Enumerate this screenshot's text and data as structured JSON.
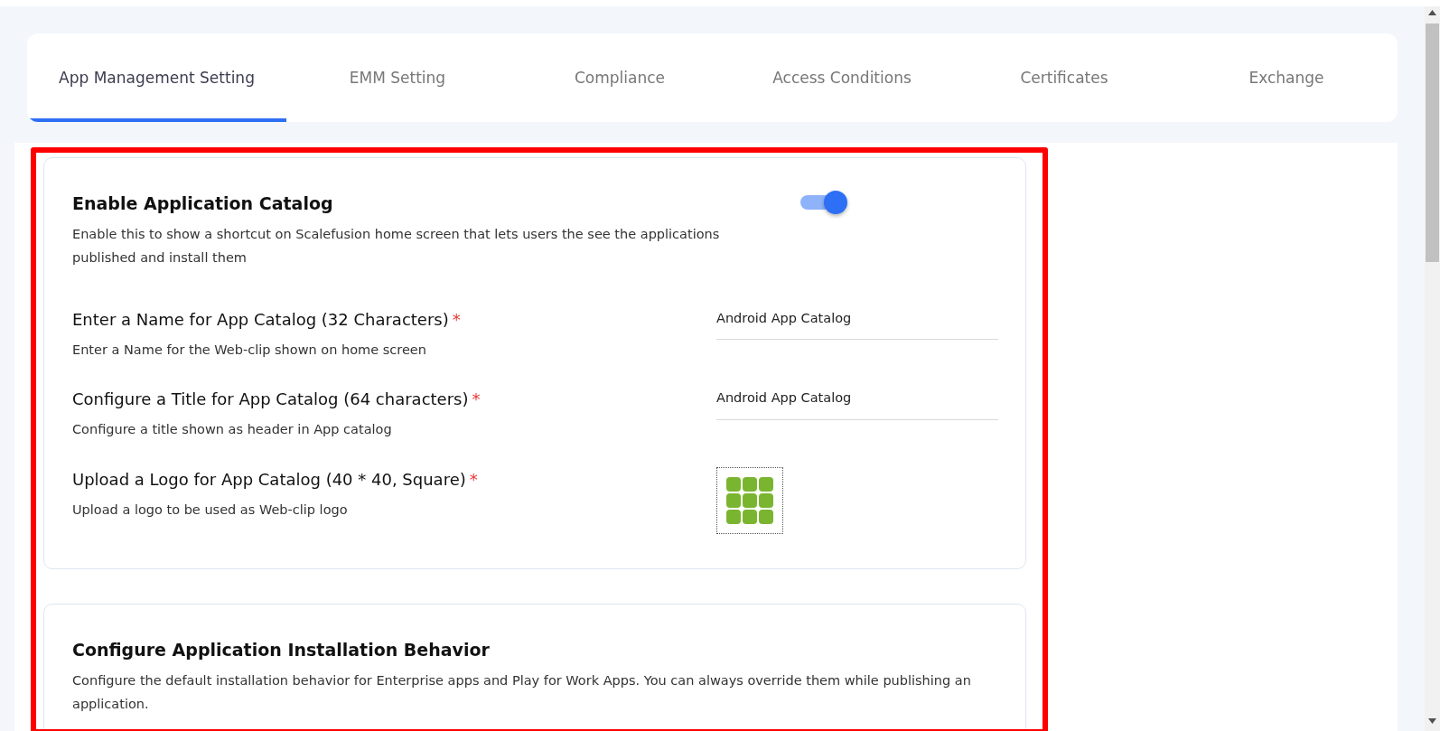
{
  "tabs": [
    {
      "label": "App Management Setting",
      "selected": true
    },
    {
      "label": "EMM Setting",
      "selected": false
    },
    {
      "label": "Compliance",
      "selected": false
    },
    {
      "label": "Access Conditions",
      "selected": false
    },
    {
      "label": "Certificates",
      "selected": false
    },
    {
      "label": "Exchange",
      "selected": false
    }
  ],
  "catalog_section": {
    "title": "Enable Application Catalog",
    "description": "Enable this to show a shortcut on Scalefusion home screen that lets users the see the applications published and install them",
    "enabled": true,
    "fields": [
      {
        "kind": "text",
        "label": "Enter a Name for App Catalog (32 Characters)",
        "required_mark": "*",
        "hint": "Enter a Name for the Web-clip shown on home screen",
        "value": "Android App Catalog"
      },
      {
        "kind": "text",
        "label": "Configure a Title for App Catalog (64 characters)",
        "required_mark": "*",
        "hint": "Configure a title shown as header in App catalog",
        "value": "Android App Catalog"
      },
      {
        "kind": "logo",
        "label": "Upload a Logo for App Catalog (40 * 40, Square)",
        "required_mark": "*",
        "hint": "Upload a logo to be used as Web-clip logo"
      }
    ]
  },
  "install_section": {
    "title": "Configure Application Installation Behavior",
    "description": "Configure the default installation behavior for Enterprise apps and Play for Work Apps. You can always override them while publishing an application."
  }
}
